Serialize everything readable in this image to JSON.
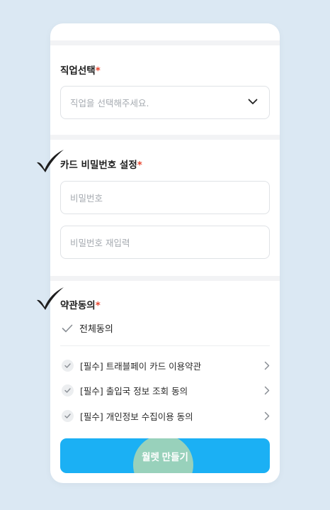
{
  "job_section": {
    "title": "직업선택",
    "required_mark": "*",
    "select_placeholder": "직업을 선택해주세요."
  },
  "pin_section": {
    "title": "카드 비밀번호 설정",
    "required_mark": "*",
    "password_placeholder": "비밀번호",
    "password_confirm_placeholder": "비밀번호 재입력"
  },
  "terms_section": {
    "title": "약관동의",
    "required_mark": "*",
    "agree_all_label": "전체동의",
    "items": [
      {
        "label": "[필수] 트래블페이 카드 이용약관"
      },
      {
        "label": "[필수] 출입국 정보 조회 동의"
      },
      {
        "label": "[필수] 개인정보 수집이용 동의"
      }
    ]
  },
  "cta": {
    "label": "월렛 만들기"
  },
  "colors": {
    "accent": "#1bb0f4",
    "required": "#e8452e",
    "background": "#dbe8f3"
  },
  "icons": [
    "chevron-down-icon",
    "check-icon",
    "chevron-right-icon",
    "tick-mark-icon"
  ]
}
